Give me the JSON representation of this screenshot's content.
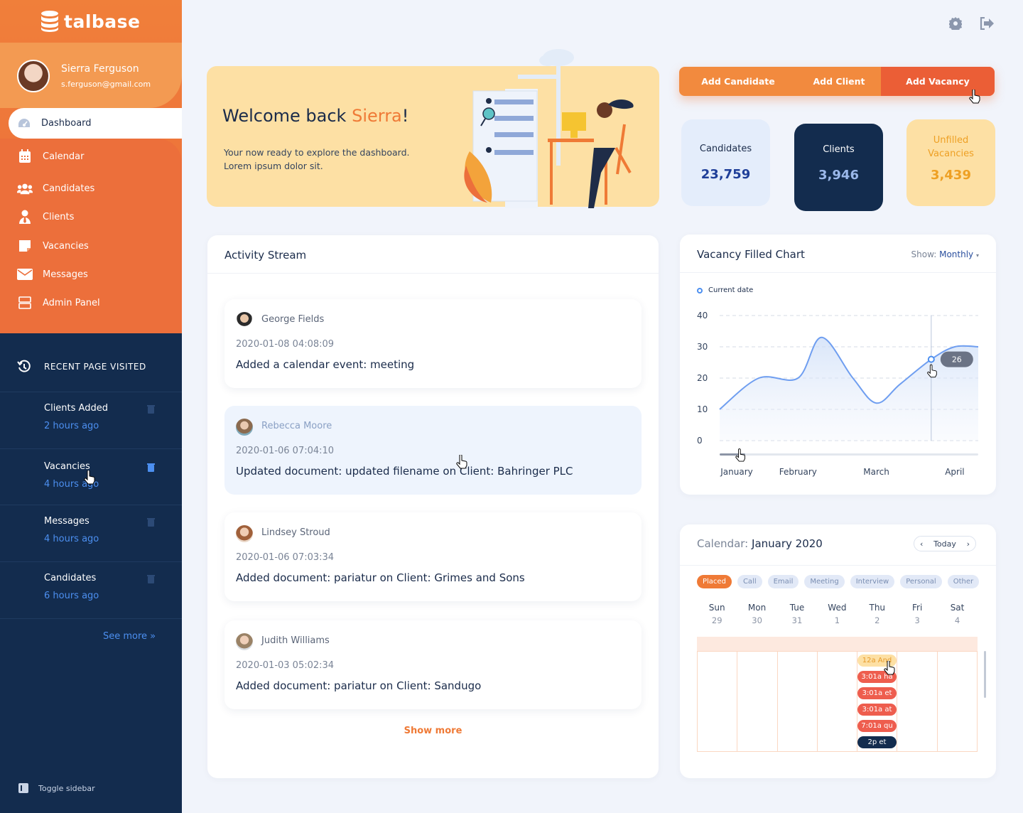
{
  "app": {
    "name": "talbase"
  },
  "user": {
    "name": "Sierra Ferguson",
    "email": "s.ferguson@gmail.com"
  },
  "nav": [
    {
      "label": "Dashboard",
      "icon": "dashboard-gauge-icon"
    },
    {
      "label": "Calendar",
      "icon": "calendar-icon"
    },
    {
      "label": "Candidates",
      "icon": "users-group-icon"
    },
    {
      "label": "Clients",
      "icon": "user-tie-icon"
    },
    {
      "label": "Vacancies",
      "icon": "sticky-note-icon"
    },
    {
      "label": "Messages",
      "icon": "envelope-icon"
    },
    {
      "label": "Admin Panel",
      "icon": "server-icon"
    }
  ],
  "recent": {
    "heading": "RECENT PAGE VISITED",
    "items": [
      {
        "title": "Clients Added",
        "time": "2 hours ago"
      },
      {
        "title": "Vacancies",
        "time": "4 hours ago"
      },
      {
        "title": "Messages",
        "time": "4 hours ago"
      },
      {
        "title": "Candidates",
        "time": "6 hours ago"
      }
    ],
    "see_more": "See more »"
  },
  "toggle_sidebar": "Toggle sidebar",
  "welcome": {
    "greeting": "Welcome back ",
    "name": "Sierra",
    "exclaim": "!",
    "text": "Your now ready to explore the dashboard. Lorem ipsum dolor sit."
  },
  "actions": {
    "add_candidate": "Add Candidate",
    "add_client": "Add Client",
    "add_vacancy": "Add Vacancy"
  },
  "stats": {
    "candidates": {
      "label": "Candidates",
      "value": "23,759"
    },
    "clients": {
      "label": "Clients",
      "value": "3,946"
    },
    "unfilled": {
      "label": "Unfilled Vacancies",
      "value": "3,439"
    }
  },
  "activity": {
    "title": "Activity Stream",
    "items": [
      {
        "name": "George Fields",
        "time": "2020-01-08 04:08:09",
        "text": "Added a calendar event: meeting"
      },
      {
        "name": "Rebecca Moore",
        "time": "2020-01-06 07:04:10",
        "text": "Updated document: updated filename on Client: Bahringer PLC"
      },
      {
        "name": "Lindsey Stroud",
        "time": "2020-01-06 07:03:34",
        "text": "Added document: pariatur on Client: Grimes and Sons"
      },
      {
        "name": "Judith Williams",
        "time": "2020-01-03 05:02:34",
        "text": "Added document: pariatur on Client: Sandugo"
      }
    ],
    "show_more": "Show more"
  },
  "chart_data": {
    "type": "area",
    "title": "Vacancy Filled Chart",
    "show_label": "Show:",
    "show_value": "Monthly",
    "legend": [
      "Current date"
    ],
    "x": [
      0,
      0.5,
      1.0,
      1.3,
      1.7,
      2.0,
      2.3,
      2.7,
      3.0,
      3.3
    ],
    "y": [
      10,
      20,
      20,
      33,
      20,
      12,
      18,
      26,
      30,
      30
    ],
    "x_labels": [
      "January",
      "February",
      "March",
      "April"
    ],
    "ylim": [
      0,
      40
    ],
    "yticks": [
      0,
      10,
      20,
      30,
      40
    ],
    "tooltip": {
      "x": 2.7,
      "value": "26"
    },
    "grid": true
  },
  "calendar": {
    "title_prefix": "Calendar:",
    "title": "January 2020",
    "today": "Today",
    "tags": [
      "Placed",
      "Call",
      "Email",
      "Meeting",
      "Interview",
      "Personal",
      "Other"
    ],
    "days": [
      {
        "d": "Sun",
        "n": "29"
      },
      {
        "d": "Mon",
        "n": "30"
      },
      {
        "d": "Tue",
        "n": "31"
      },
      {
        "d": "Wed",
        "n": "1"
      },
      {
        "d": "Thu",
        "n": "2"
      },
      {
        "d": "Fri",
        "n": "3"
      },
      {
        "d": "Sat",
        "n": "4"
      }
    ],
    "events": [
      "12a And",
      "3:01a ha",
      "3:01a et",
      "3:01a at",
      "7:01a qu",
      "2p et"
    ]
  }
}
